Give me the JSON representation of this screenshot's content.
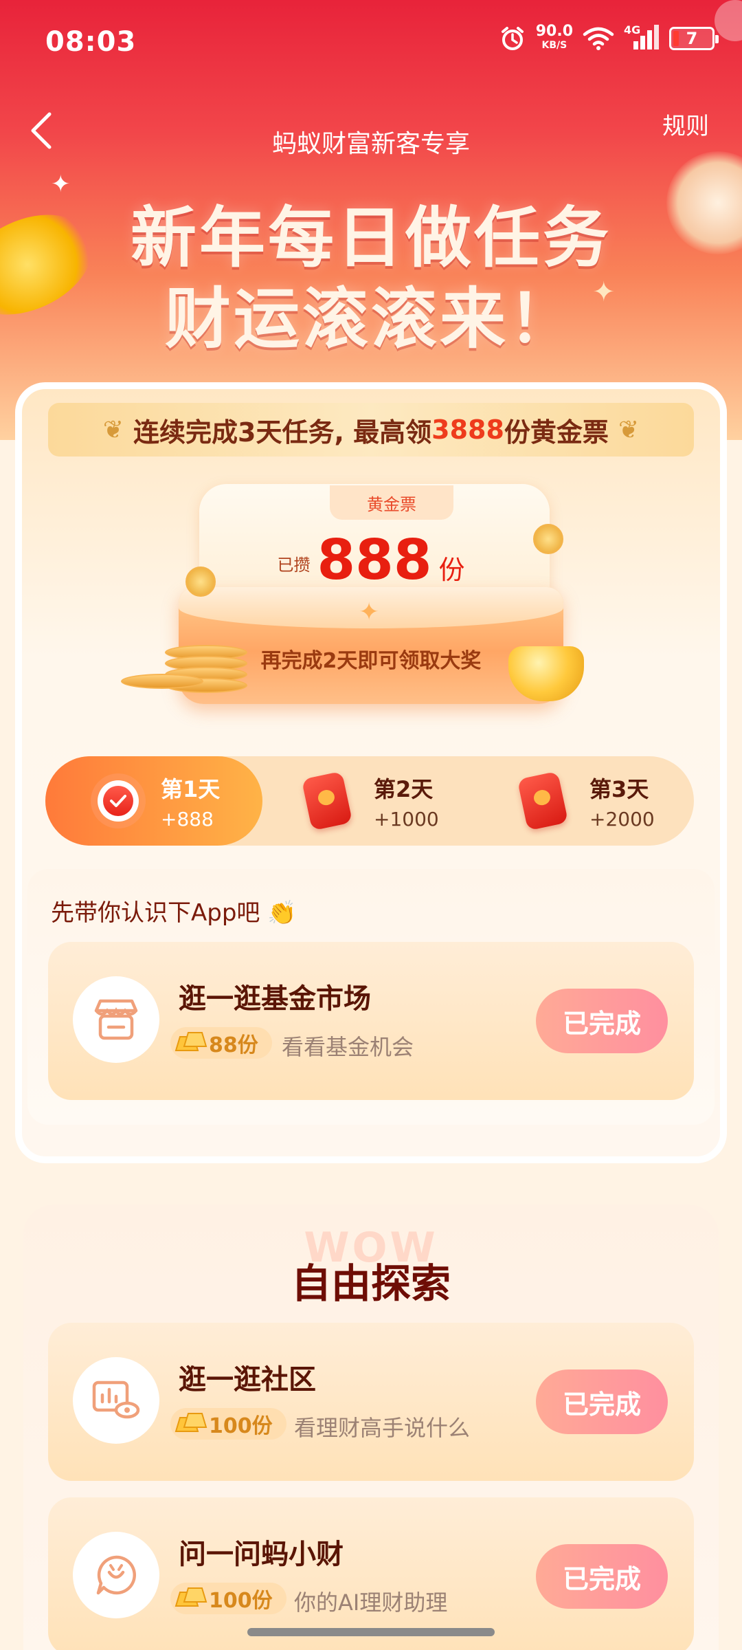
{
  "status_bar": {
    "time": "08:03",
    "net_speed_value": "90.0",
    "net_speed_unit": "KB/S",
    "network": "4G",
    "battery": "7",
    "icons": [
      "alarm-icon",
      "wifi-icon",
      "signal-icon",
      "battery-icon"
    ]
  },
  "nav": {
    "title": "蚂蚁财富新客专享",
    "rules": "规则"
  },
  "hero": {
    "line1": "新年每日做任务",
    "line2": "财运滚滚来！"
  },
  "banner": {
    "text_before": "连续完成3天任务, 最高领",
    "highlight": "3888",
    "text_after": "份黄金票"
  },
  "ticket": {
    "label": "黄金票",
    "prefix": "已攒",
    "amount": "888",
    "unit": "份",
    "hint": "再完成2天即可领取大奖"
  },
  "days": [
    {
      "label": "第1天",
      "bonus": "+888",
      "done": true
    },
    {
      "label": "第2天",
      "bonus": "+1000",
      "done": false
    },
    {
      "label": "第3天",
      "bonus": "+2000",
      "done": false
    }
  ],
  "intro": {
    "title": "先带你认识下App吧 👏",
    "task": {
      "title": "逛一逛基金市场",
      "reward": "88份",
      "desc": "看看基金机会",
      "button": "已完成"
    }
  },
  "explore": {
    "watermark": "WOW",
    "title": "自由探索",
    "tasks": [
      {
        "title": "逛一逛社区",
        "reward": "100份",
        "desc": "看理财高手说什么",
        "button": "已完成"
      },
      {
        "title": "问一问蚂小财",
        "reward": "100份",
        "desc": "你的AI理财助理",
        "button": "已完成"
      }
    ]
  },
  "colors": {
    "brand_red": "#e8233a",
    "accent_orange": "#ff7a3a",
    "amount_red": "#e81f10",
    "done_button": "#ff8f9f"
  }
}
